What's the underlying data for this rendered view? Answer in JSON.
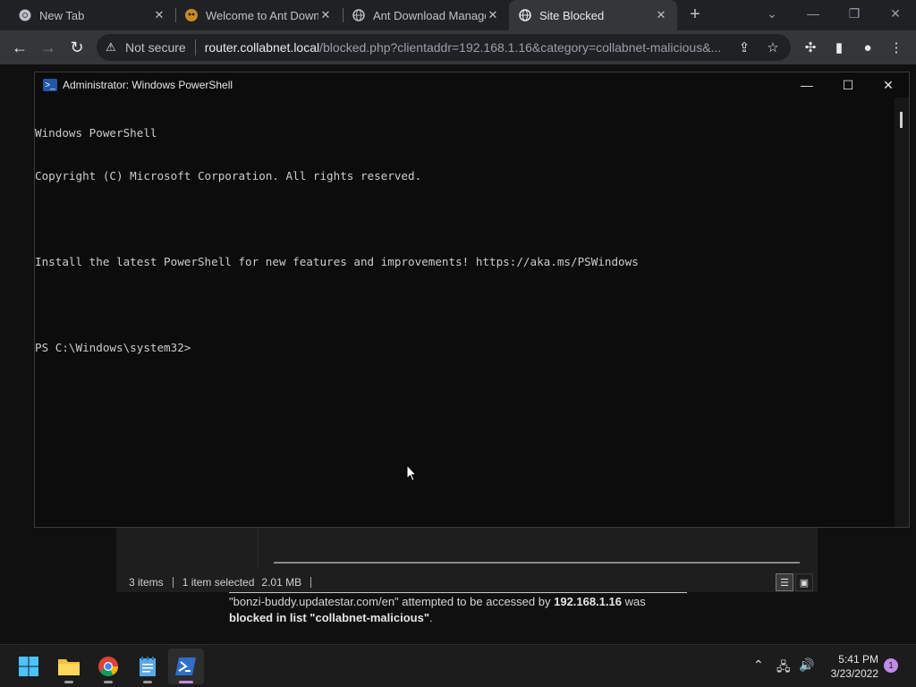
{
  "browser": {
    "tabs": [
      {
        "title": "New Tab",
        "icon": "chrome-icon"
      },
      {
        "title": "Welcome to Ant Downl",
        "icon": "ant-icon"
      },
      {
        "title": "Ant Download Manage",
        "icon": "globe-icon"
      },
      {
        "title": "Site Blocked",
        "icon": "globe-icon",
        "active": true
      }
    ],
    "omnibox": {
      "security": "Not secure",
      "host": "router.collabnet.local",
      "path": "/blocked.php?clientaddr=192.168.1.16&category=collabnet-malicious&..."
    }
  },
  "explorer_bg": {
    "items_count": "3 items",
    "selected": "1 item selected",
    "size": "2.01 MB"
  },
  "blocked_page": {
    "url_quote": "\"bonzi-buddy.updatestar.com/en\" attempted to be accessed by ",
    "ip": "192.168.1.16",
    "was": " was",
    "blocked_in": "blocked in list \"collabnet-malicious\"",
    "period": "."
  },
  "powershell": {
    "title": "Administrator: Windows PowerShell",
    "lines": [
      "Windows PowerShell",
      "Copyright (C) Microsoft Corporation. All rights reserved.",
      "",
      "Install the latest PowerShell for new features and improvements! https://aka.ms/PSWindows",
      "",
      "PS C:\\Windows\\system32>"
    ]
  },
  "taskbar": {
    "clock_time": "5:41 PM",
    "clock_date": "3/23/2022",
    "notifications": "1"
  },
  "colors": {
    "ps_background": "#0c0c0c",
    "chrome_tabstrip": "#202124",
    "taskbar_accent": "#c08be6"
  }
}
